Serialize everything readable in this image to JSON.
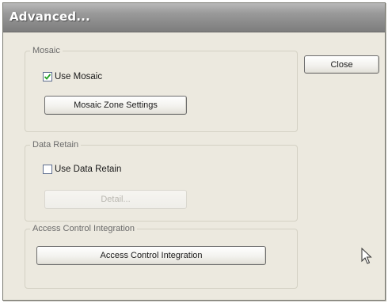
{
  "window": {
    "title": "Advanced..."
  },
  "groups": {
    "mosaic": {
      "title": "Mosaic",
      "checkbox_label": "Use Mosaic",
      "checked": true,
      "button_label": "Mosaic Zone Settings"
    },
    "data_retain": {
      "title": "Data Retain",
      "checkbox_label": "Use Data Retain",
      "checked": false,
      "button_label": "Detail..."
    },
    "access_control": {
      "title": "Access Control Integration",
      "button_label": "Access Control Integration"
    }
  },
  "close_button": {
    "label": "Close"
  },
  "icons": {
    "checkmark": "check-icon",
    "cursor": "mouse-pointer-icon"
  }
}
